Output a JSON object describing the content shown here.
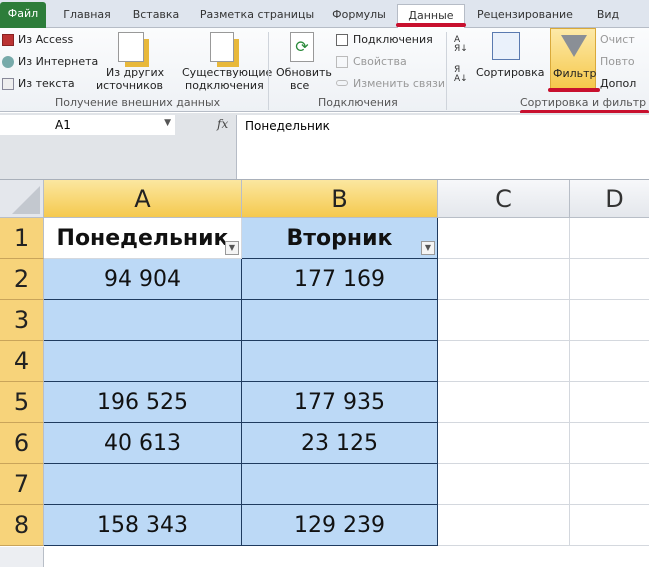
{
  "tabs": [
    "Файл",
    "Главная",
    "Вставка",
    "Разметка страницы",
    "Формулы",
    "Данные",
    "Рецензирование",
    "Вид"
  ],
  "active_tab": "Данные",
  "ribbon": {
    "external": {
      "access": "Из Access",
      "web": "Из Интернета",
      "text": "Из текста",
      "other1": "Из других",
      "other2": "источников",
      "existing1": "Существующие",
      "existing2": "подключения",
      "label": "Получение внешних данных"
    },
    "connections": {
      "refresh1": "Обновить",
      "refresh2": "все",
      "conn": "Подключения",
      "props": "Свойства",
      "links": "Изменить связи",
      "label": "Подключения"
    },
    "sort": {
      "sort": "Сортировка",
      "filter": "Фильтр",
      "clear": "Очист",
      "reapply": "Повто",
      "advanced": "Допол",
      "label": "Сортировка и фильтр"
    }
  },
  "formula_bar": {
    "name_box": "A1",
    "fx": "fx",
    "value": "Понедельник"
  },
  "columns": [
    "A",
    "B",
    "C",
    "D"
  ],
  "rows": [
    "1",
    "2",
    "3",
    "4",
    "5",
    "6",
    "7",
    "8"
  ],
  "table": {
    "headers": [
      "Понедельник",
      "Вторник"
    ],
    "data": [
      [
        "94 904",
        "177 169"
      ],
      [
        "",
        ""
      ],
      [
        "",
        ""
      ],
      [
        "196 525",
        "177 935"
      ],
      [
        "40 613",
        "23 125"
      ],
      [
        "",
        ""
      ],
      [
        "158 343",
        "129 239"
      ]
    ]
  },
  "colors": {
    "highlight": "#c8102e",
    "table_fill": "#bcd9f6",
    "filter_active": "#f8d868"
  }
}
